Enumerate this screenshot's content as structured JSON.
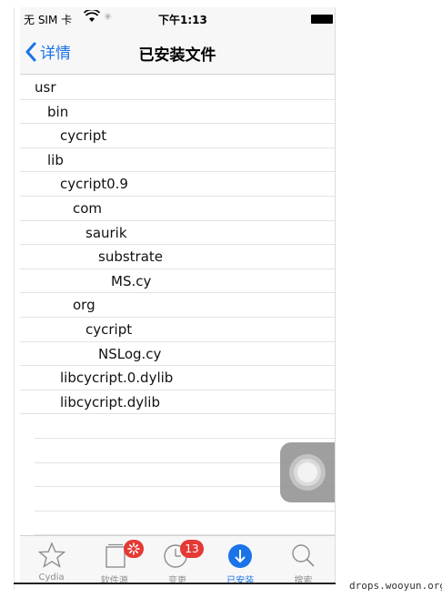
{
  "status_bar": {
    "carrier": "无 SIM 卡",
    "time": "下午1:13",
    "wifi_icon": "wifi-icon",
    "activity_icon": "spinner-icon",
    "battery_icon": "battery-icon"
  },
  "nav": {
    "back_label": "详情",
    "title": "已安装文件",
    "back_icon": "chevron-left-icon"
  },
  "files": [
    {
      "name": "usr",
      "depth": 0
    },
    {
      "name": "bin",
      "depth": 1
    },
    {
      "name": "cycript",
      "depth": 2
    },
    {
      "name": "lib",
      "depth": 1
    },
    {
      "name": "cycript0.9",
      "depth": 2
    },
    {
      "name": "com",
      "depth": 3
    },
    {
      "name": "saurik",
      "depth": 4
    },
    {
      "name": "substrate",
      "depth": 5
    },
    {
      "name": "MS.cy",
      "depth": 6
    },
    {
      "name": "org",
      "depth": 3
    },
    {
      "name": "cycript",
      "depth": 4
    },
    {
      "name": "NSLog.cy",
      "depth": 5
    },
    {
      "name": "libcycript.0.dylib",
      "depth": 2
    },
    {
      "name": "libcycript.dylib",
      "depth": 2
    }
  ],
  "tab_bar": {
    "tabs": [
      {
        "label": "Cydia",
        "icon": "star-icon",
        "badge": ""
      },
      {
        "label": "软件源",
        "icon": "sources-icon",
        "badge": "loading"
      },
      {
        "label": "变更",
        "icon": "clock-icon",
        "badge": "13"
      },
      {
        "label": "已安装",
        "icon": "download-icon",
        "badge": "",
        "active": true
      },
      {
        "label": "搜索",
        "icon": "search-icon",
        "badge": ""
      }
    ]
  },
  "colors": {
    "accent": "#1a73e8",
    "badge": "#e53935"
  },
  "watermark": "drops.wooyun.org"
}
